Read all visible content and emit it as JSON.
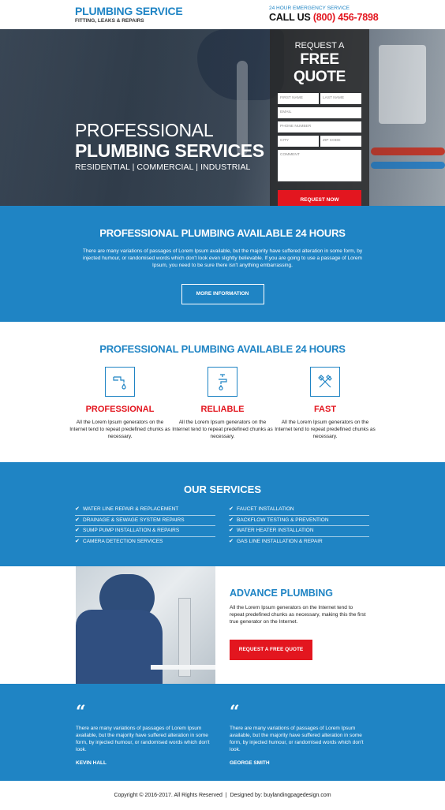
{
  "header": {
    "logo_title": "PLUMBING SERVICE",
    "logo_tagline": "FITTING, LEAKS & REPAIRS",
    "emergency": "24 HOUR EMERGENCY SERVICE",
    "call_label": "CALL US",
    "phone": "(800) 456-7898"
  },
  "hero": {
    "title_line1": "PROFESSIONAL",
    "title_line2": "PLUMBING SERVICES",
    "subtitle": "RESIDENTIAL | COMMERCIAL | INDUSTRIAL"
  },
  "quote_form": {
    "heading_small": "REQUEST A",
    "heading_big": "FREE QUOTE",
    "first_name": "FIRST NAME",
    "last_name": "LAST NAME",
    "email": "EMAIL",
    "phone": "PHONE NUMBER",
    "city": "CITY",
    "zip": "ZIP CODE",
    "comment": "COMMENT",
    "submit": "REQUEST NOW"
  },
  "intro": {
    "title": "PROFESSIONAL PLUMBING AVAILABLE 24 HOURS",
    "text": "There are many variations of passages of Lorem Ipsum available, but the majority have suffered alteration in some form, by injected humour, or randomised words which don't look even slightly believable. If you are going to use a passage of Lorem Ipsum, you need to be sure there isn't anything embarrassing.",
    "button": "MORE INFORMATION"
  },
  "features": {
    "title": "PROFESSIONAL PLUMBING AVAILABLE 24 HOURS",
    "items": [
      {
        "icon": "faucet-drip-icon",
        "title": "PROFESSIONAL",
        "text": "All the Lorem Ipsum generators on the Internet tend to repeat predefined chunks as necessary."
      },
      {
        "icon": "tap-water-icon",
        "title": "RELIABLE",
        "text": "All the Lorem Ipsum generators on the Internet tend to repeat predefined chunks as necessary."
      },
      {
        "icon": "tools-icon",
        "title": "FAST",
        "text": "All the Lorem Ipsum generators on the Internet tend to repeat predefined chunks as necessary."
      }
    ]
  },
  "services": {
    "title": "OUR SERVICES",
    "left": [
      "WATER LINE REPAIR & REPLACEMENT",
      "DRAINAGE & SEWAGE SYSTEM REPAIRS",
      "SUMP PUMP INSTALLATION & REPAIRS",
      "CAMERA DETECTION SERVICES"
    ],
    "right": [
      "FAUCET INSTALLATION",
      "BACKFLOW TESTING & PREVENTION",
      "WATER HEATER INSTALLATION",
      "GAS LINE INSTALLATION & REPAIR"
    ]
  },
  "advance": {
    "title": "ADVANCE PLUMBING",
    "text": "All the Lorem Ipsum generators on the Internet tend to repeat predefined chunks as necessary, making this the first true generator on the Internet.",
    "button": "REQUEST A FREE QUOTE"
  },
  "testimonials": [
    {
      "text": "There are many variations of passages of Lorem Ipsum available, but the majority have suffered alteration in some form, by injected humour, or randomised words which don't look.",
      "name": "KEVIN HALL"
    },
    {
      "text": "There are many variations of passages of Lorem Ipsum available, but the majority have suffered alteration in some form, by injected humour, or randomised words which don't look.",
      "name": "GEORGE SMITH"
    }
  ],
  "footer": {
    "copyright": "Copyright © 2016-2017. All Rights Reserved  |  Designed by: buylandingpagedesign.com"
  },
  "colors": {
    "primary": "#1f84c4",
    "accent": "#e3161f",
    "form_bg": "#2b2b2b"
  }
}
